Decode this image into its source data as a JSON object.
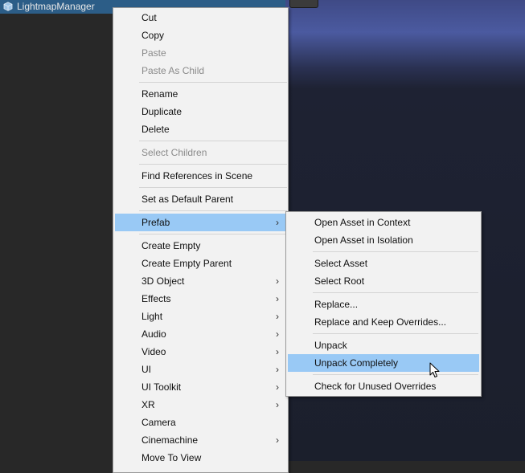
{
  "hierarchy": {
    "selected_object": "LightmapManager"
  },
  "context_menu": {
    "cut": "Cut",
    "copy": "Copy",
    "paste": "Paste",
    "paste_as_child": "Paste As Child",
    "rename": "Rename",
    "duplicate": "Duplicate",
    "delete": "Delete",
    "select_children": "Select Children",
    "find_references": "Find References in Scene",
    "set_default_parent": "Set as Default Parent",
    "prefab": "Prefab",
    "create_empty": "Create Empty",
    "create_empty_parent": "Create Empty Parent",
    "object_3d": "3D Object",
    "effects": "Effects",
    "light": "Light",
    "audio": "Audio",
    "video": "Video",
    "ui": "UI",
    "ui_toolkit": "UI Toolkit",
    "xr": "XR",
    "camera": "Camera",
    "cinemachine": "Cinemachine",
    "move_to_view": "Move To View"
  },
  "prefab_submenu": {
    "open_in_context": "Open Asset in Context",
    "open_in_isolation": "Open Asset in Isolation",
    "select_asset": "Select Asset",
    "select_root": "Select Root",
    "replace": "Replace...",
    "replace_keep_overrides": "Replace and Keep Overrides...",
    "unpack": "Unpack",
    "unpack_completely": "Unpack Completely",
    "check_unused_overrides": "Check for Unused Overrides"
  },
  "icons": {
    "submenu_arrow": "chevron-right-icon",
    "gameobject": "cube-icon",
    "cursor": "mouse-pointer-icon"
  },
  "colors": {
    "highlight": "#99c9f5",
    "menu_bg": "#f2f2f2",
    "selection_row": "#2c5d87"
  }
}
